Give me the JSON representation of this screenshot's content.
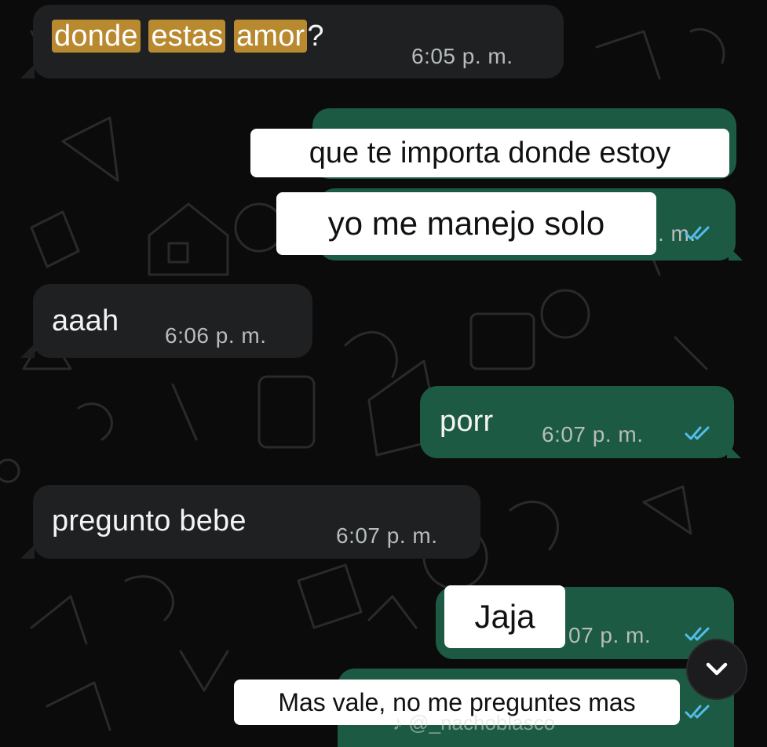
{
  "messages": [
    {
      "id": "m1",
      "direction": "incoming",
      "parts": [
        "donde",
        "estas",
        "amor",
        "?"
      ],
      "time": "6:05 p. m."
    },
    {
      "id": "m2",
      "direction": "outgoing",
      "text": "que te importa donde estoy"
    },
    {
      "id": "m3",
      "direction": "outgoing",
      "text": "yo me manejo solo",
      "time_partial": ". m.",
      "status": "read"
    },
    {
      "id": "m4",
      "direction": "incoming",
      "text": "aaah",
      "time": "6:06 p. m."
    },
    {
      "id": "m5",
      "direction": "outgoing",
      "text": "porr",
      "time": "6:07 p. m.",
      "status": "read"
    },
    {
      "id": "m6",
      "direction": "incoming",
      "text": "pregunto bebe",
      "time": "6:07 p. m."
    },
    {
      "id": "m7",
      "direction": "outgoing",
      "text": "Jaja",
      "time_partial": "07 p. m.",
      "status": "read"
    },
    {
      "id": "m8",
      "direction": "outgoing",
      "text": "Mas vale, no me preguntes mas",
      "status": "read"
    }
  ],
  "scroll_button": {
    "icon": "chevron-down-icon"
  },
  "watermark": {
    "text": "♪ @_nachoblasco"
  },
  "colors": {
    "background": "#0b0b0b",
    "incoming_bubble": "#1f2022",
    "outgoing_bubble": "#1d5a43",
    "read_ticks": "#53bdeb",
    "highlight": "#b8892f"
  }
}
